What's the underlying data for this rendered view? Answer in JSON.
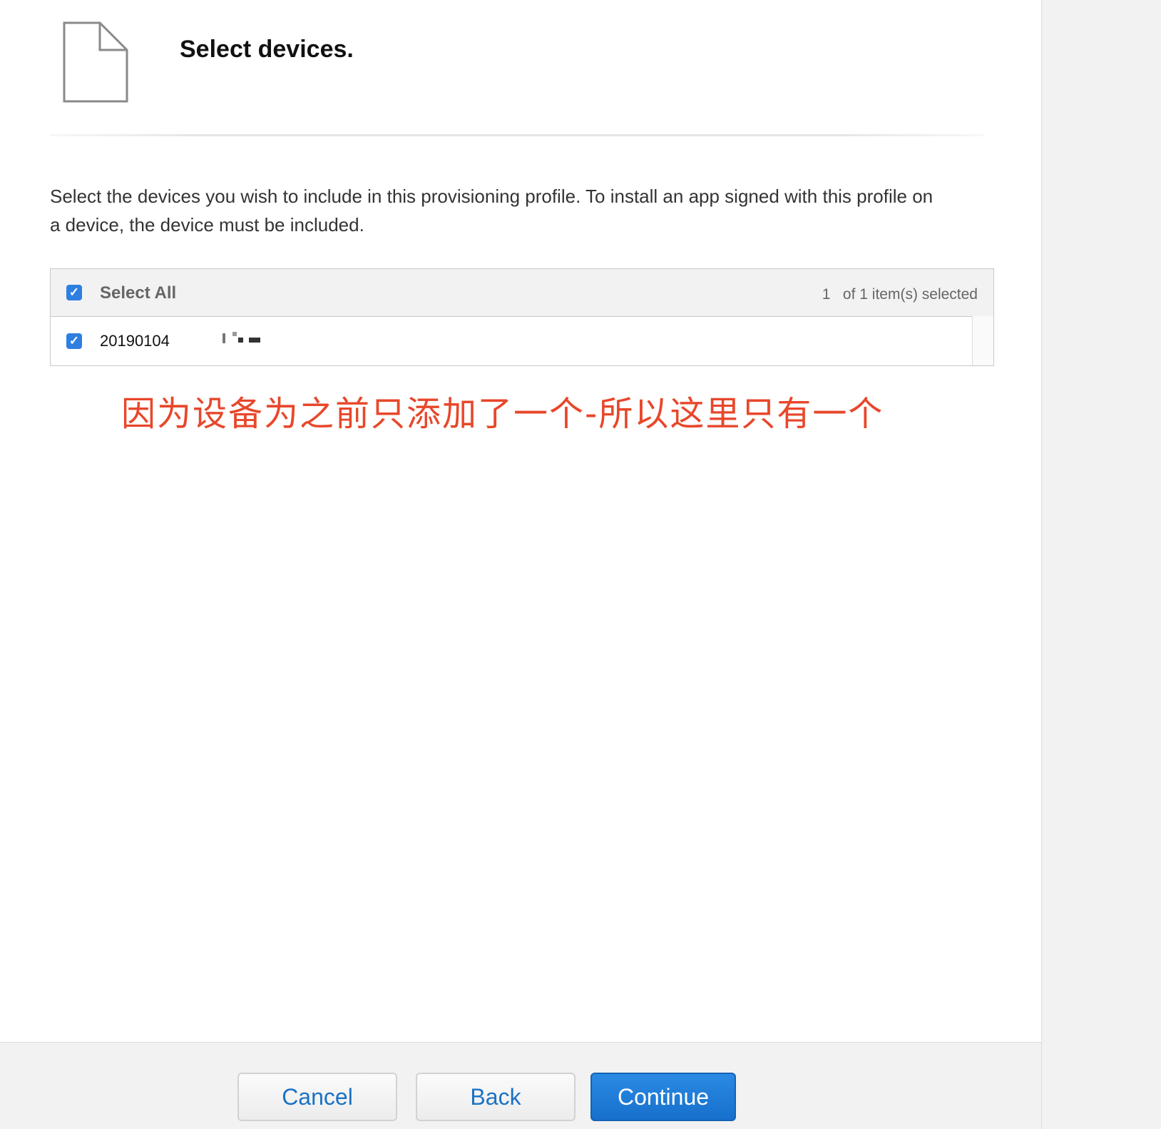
{
  "header": {
    "title": "Select devices.",
    "icon": "document-icon"
  },
  "description": "Select the devices you wish to include in this provisioning profile. To install an app signed with this profile on a device, the device must be included.",
  "device_table": {
    "select_all_label": "Select All",
    "select_all_checked": true,
    "selection_count": "1   of 1 item(s) selected",
    "rows": [
      {
        "name": "20190104",
        "checked": true
      }
    ]
  },
  "annotation": "因为设备为之前只添加了一个-所以这里只有一个",
  "footer": {
    "cancel_label": "Cancel",
    "back_label": "Back",
    "continue_label": "Continue"
  },
  "colors": {
    "accent": "#1b72c4",
    "checkbox": "#2f7fe0",
    "annotation": "#e8472b",
    "footer_bg": "#f2f2f2"
  }
}
